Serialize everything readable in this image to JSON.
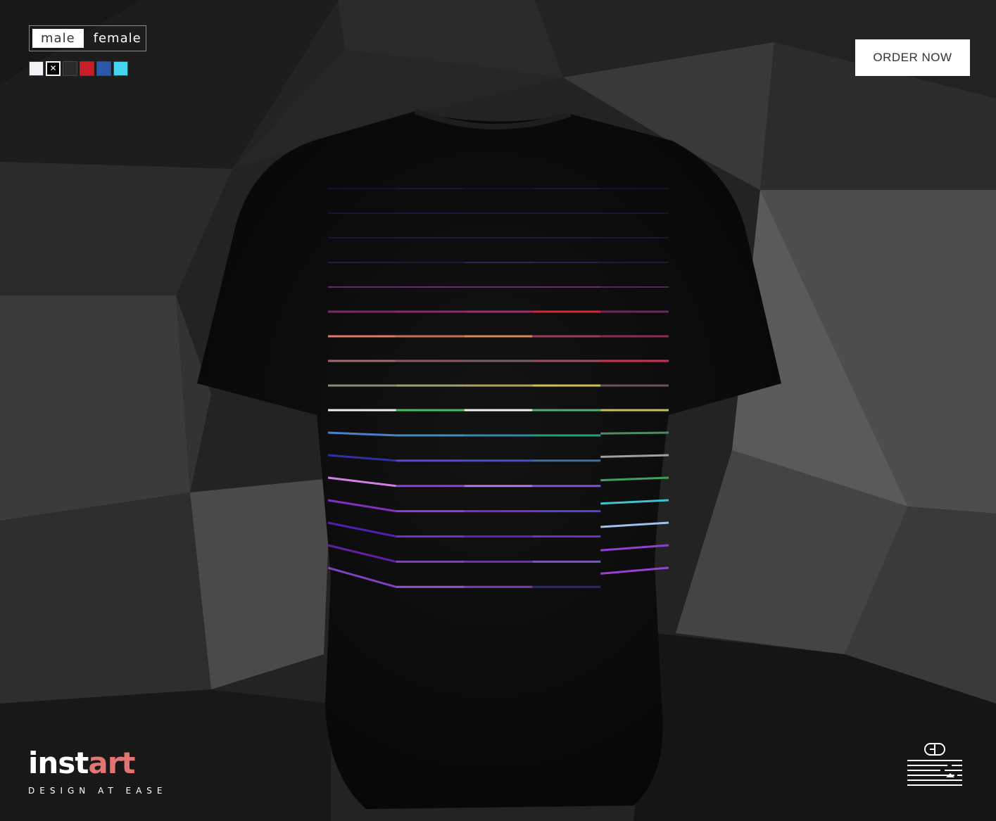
{
  "gender_toggle": {
    "options": [
      {
        "label": "male",
        "active": true
      },
      {
        "label": "female",
        "active": false
      }
    ]
  },
  "color_swatches": [
    {
      "color": "#f2f2f7",
      "selected": false
    },
    {
      "color": "#000000",
      "selected": true,
      "mark": "✕"
    },
    {
      "color": "#2a2a2a",
      "selected": false
    },
    {
      "color": "#c81e2a",
      "selected": false
    },
    {
      "color": "#2d57a8",
      "selected": false
    },
    {
      "color": "#46d4ef",
      "selected": false
    }
  ],
  "order_button": {
    "label": "ORDER NOW"
  },
  "brand": {
    "name_part1": "inst",
    "name_part2": "art",
    "tagline": "DESIGN AT EASE",
    "accent_color": "#e27572"
  },
  "shirt": {
    "color": "#0f0f0f"
  },
  "icons": {
    "corner": "mouse-scroll-icon"
  }
}
